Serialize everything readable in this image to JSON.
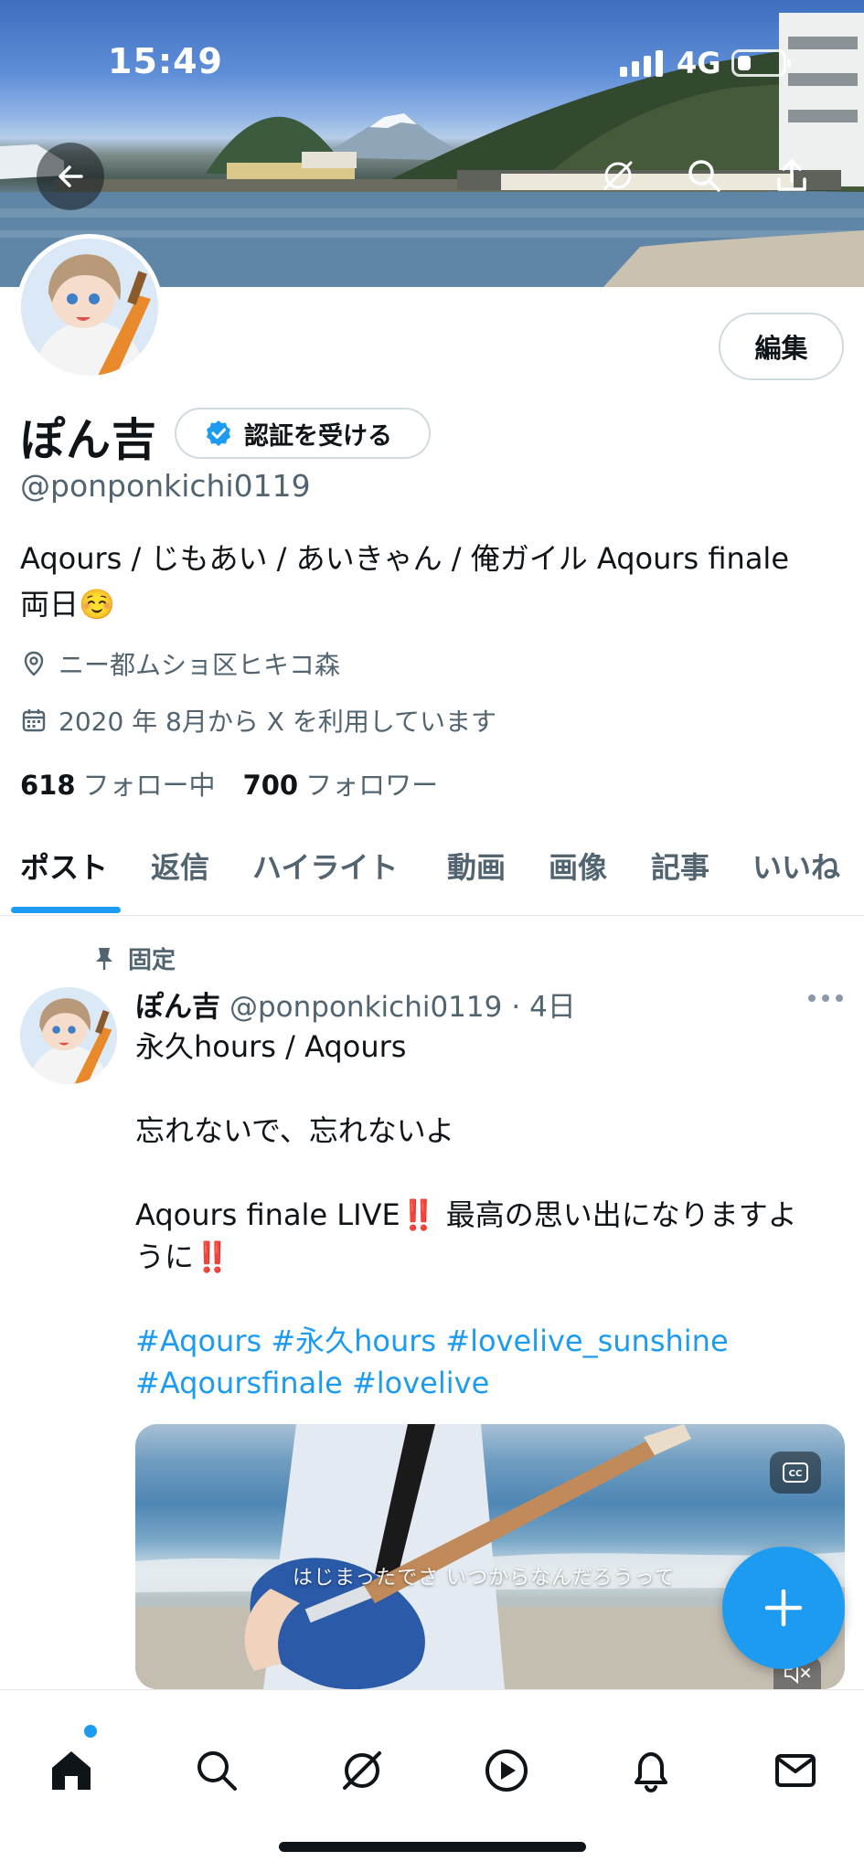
{
  "status_bar": {
    "time": "15:49",
    "network": "4G"
  },
  "header": {
    "back_icon": "arrow-left-icon",
    "grok_icon": "grok-icon",
    "search_icon": "search-icon",
    "share_icon": "share-icon"
  },
  "profile": {
    "edit_label": "編集",
    "display_name": "ぽん吉",
    "verify_label": "認証を受ける",
    "handle": "@ponponkichi0119",
    "bio_line1": "Aqours / じもあい / あいきゃん / 俺ガイル Aqours finale",
    "bio_line2": "両日☺️",
    "location": "ニー都ムショ区ヒキコ森",
    "joined": "2020 年 8月から X を利用しています",
    "following_count": "618",
    "following_label": "フォロー中",
    "followers_count": "700",
    "followers_label": "フォロワー"
  },
  "tabs": [
    {
      "label": "ポスト",
      "active": true
    },
    {
      "label": "返信",
      "active": false
    },
    {
      "label": "ハイライト",
      "active": false
    },
    {
      "label": "動画",
      "active": false
    },
    {
      "label": "画像",
      "active": false
    },
    {
      "label": "記事",
      "active": false
    },
    {
      "label": "いいね",
      "active": false
    }
  ],
  "post": {
    "pinned_label": "固定",
    "author_name": "ぽん吉",
    "author_handle": "@ponponkichi0119",
    "time": "· 4日",
    "line1": "永久hours / Aqours",
    "line2": "忘れないで、忘れないよ",
    "line3": "Aqours finale LIVE‼️ 最高の思い出になりますよ",
    "line4": "うに‼️",
    "hashtags_line1": "#Aqours #永久hours #lovelive_sunshine",
    "hashtags_line2": "#Aqoursfinale #lovelive",
    "video_caption": "はじまったでさ いつからなんだろうって"
  },
  "colors": {
    "accent": "#1d9bf0",
    "text_primary": "#0f1419",
    "text_secondary": "#536471",
    "border": "#cfd9de"
  },
  "bottom_nav": [
    {
      "icon": "home-icon",
      "active": true
    },
    {
      "icon": "search-icon",
      "active": false
    },
    {
      "icon": "grok-icon",
      "active": false
    },
    {
      "icon": "video-icon",
      "active": false
    },
    {
      "icon": "bell-icon",
      "active": false
    },
    {
      "icon": "mail-icon",
      "active": false
    }
  ]
}
